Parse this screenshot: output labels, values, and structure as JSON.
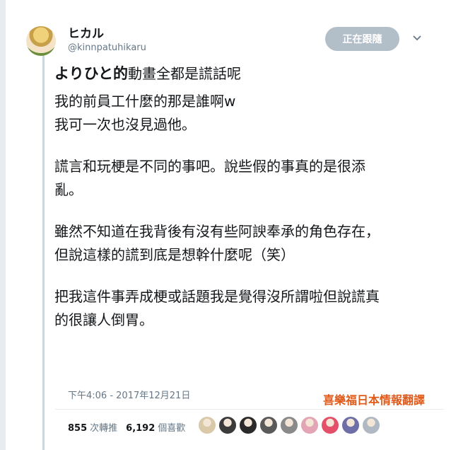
{
  "user": {
    "display_name": "ヒカル",
    "handle": "@kinnpatuhikaru"
  },
  "follow_button": "正在跟隨",
  "tweet": {
    "title_bold": "よりひと的",
    "title_rest": "動畫全都是謊話呢",
    "para1": [
      "我的前員工什麼的那是誰啊w",
      "我可一次也沒見過他。"
    ],
    "para2": [
      "謊言和玩梗是不同的事吧。說些假的事真的是很添",
      "亂。"
    ],
    "para3": [
      "雖然不知道在我背後有沒有些阿諛奉承的角色存在，",
      "但說這樣的謊到底是想幹什麼呢（笑）"
    ],
    "para4": [
      "把我這件事弄成梗或話題我是覺得沒所謂啦但說謊真",
      "的很讓人倒胃。"
    ]
  },
  "timestamp": "下午4:06 - 2017年12月21日",
  "watermark": "喜樂福日本情報翻譯",
  "stats": {
    "retweets_count": "855",
    "retweets_label": "次轉推",
    "likes_count": "6,192",
    "likes_label": "個喜歡"
  },
  "colors": {
    "follow_bg": "#b2bec8",
    "watermark": "#e05a1a",
    "secondary_text": "#657786"
  },
  "likers": [
    "#d9c9a8",
    "#3b3b3b",
    "#2a2a2a",
    "#5a5a5a",
    "#8a8a8a",
    "#e3a5b5",
    "#e4506a",
    "#6f6fa8",
    "#b0b8c4"
  ]
}
